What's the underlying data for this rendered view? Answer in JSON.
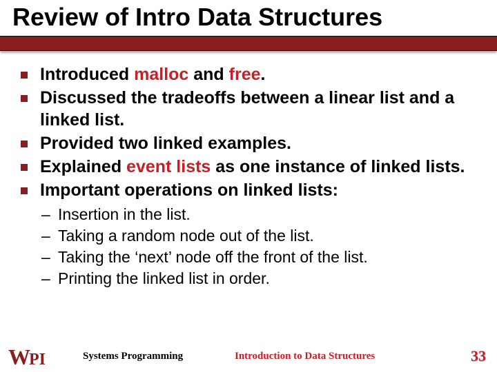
{
  "title": "Review of Intro Data Structures",
  "bullets": {
    "b1_pre": "Introduced ",
    "b1_m1": "malloc",
    "b1_mid": " and ",
    "b1_m2": "free",
    "b1_post": ".",
    "b2": "Discussed the tradeoffs between a linear list and a linked list.",
    "b3": "Provided two linked examples.",
    "b4_pre": "Explained ",
    "b4_ev": "event lists",
    "b4_post": " as one instance of linked lists.",
    "b5": "Important operations on linked lists:"
  },
  "sub": {
    "s1": "Insertion in the list.",
    "s2": "Taking a random node out of the list.",
    "s3": "Taking the ‘next’ node off the front of the list.",
    "s4": "Printing the linked list in order."
  },
  "footer": {
    "course": "Systems Programming",
    "topic": "Introduction to Data Structures",
    "page": "33",
    "logo_w": "W",
    "logo_p": "P",
    "logo_i": "I"
  },
  "colors": {
    "accent": "#8a1e1e",
    "highlight": "#c42026"
  }
}
